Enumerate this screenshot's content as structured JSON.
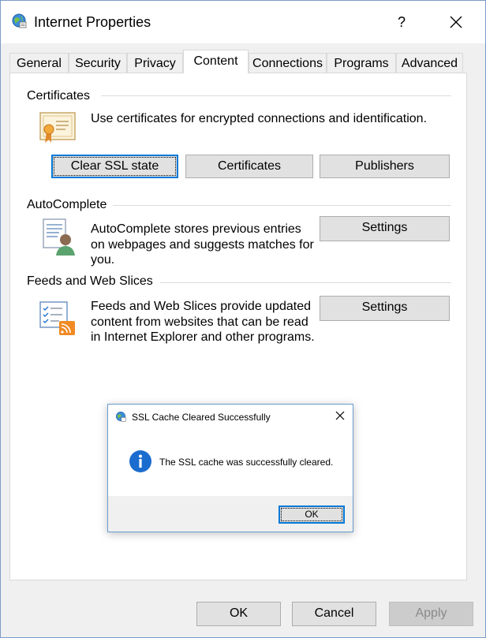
{
  "window": {
    "title": "Internet Properties",
    "help_label": "?"
  },
  "tabs": [
    {
      "label": "General",
      "active": false
    },
    {
      "label": "Security",
      "active": false
    },
    {
      "label": "Privacy",
      "active": false
    },
    {
      "label": "Content",
      "active": true
    },
    {
      "label": "Connections",
      "active": false
    },
    {
      "label": "Programs",
      "active": false
    },
    {
      "label": "Advanced",
      "active": false
    }
  ],
  "certificates": {
    "group_label": "Certificates",
    "description": "Use certificates for encrypted connections and identification.",
    "clear_ssl_label": "Clear SSL state",
    "certificates_label": "Certificates",
    "publishers_label": "Publishers"
  },
  "autocomplete": {
    "group_label": "AutoComplete",
    "description": "AutoComplete stores previous entries on webpages and suggests matches for you.",
    "settings_label": "Settings"
  },
  "feeds": {
    "group_label": "Feeds and Web Slices",
    "description": "Feeds and Web Slices provide updated content from websites that can be read in Internet Explorer and other programs.",
    "settings_label": "Settings"
  },
  "footer": {
    "ok_label": "OK",
    "cancel_label": "Cancel",
    "apply_label": "Apply"
  },
  "message_box": {
    "title": "SSL Cache Cleared Successfully",
    "text": "The SSL cache was successfully cleared.",
    "ok_label": "OK"
  },
  "colors": {
    "accent": "#0078d7",
    "window_bg": "#f0f0f0",
    "button_bg": "#e1e1e1"
  },
  "icons": {
    "app": "internet-globe-icon",
    "certificate": "certificate-icon",
    "autocomplete": "autocomplete-user-icon",
    "feeds": "feeds-rss-icon",
    "info": "info-icon",
    "close": "close-icon"
  }
}
